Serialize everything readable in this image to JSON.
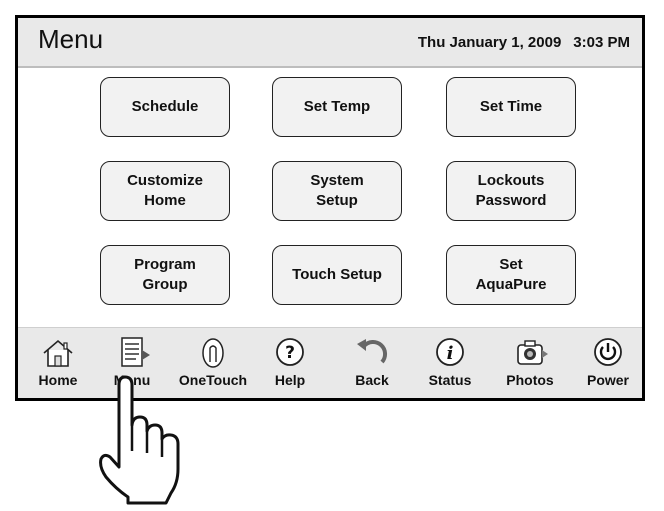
{
  "header": {
    "title": "Menu",
    "date": "Thu January 1, 2009",
    "time": "3:03 PM"
  },
  "menu_buttons": [
    {
      "label": "Schedule"
    },
    {
      "label": "Set Temp"
    },
    {
      "label": "Set Time"
    },
    {
      "label": "Customize\nHome"
    },
    {
      "label": "System\nSetup"
    },
    {
      "label": "Lockouts\nPassword"
    },
    {
      "label": "Program\nGroup"
    },
    {
      "label": "Touch Setup"
    },
    {
      "label": "Set\nAquaPure"
    }
  ],
  "nav_bar": [
    {
      "label": "Home",
      "icon": "house-icon"
    },
    {
      "label": "Menu",
      "icon": "menu-page-icon"
    },
    {
      "label": "OneTouch",
      "icon": "finger-touch-icon"
    },
    {
      "label": "Help",
      "icon": "question-icon"
    },
    {
      "label": "Back",
      "icon": "back-arrow-icon"
    },
    {
      "label": "Status",
      "icon": "info-icon"
    },
    {
      "label": "Photos",
      "icon": "camera-icon"
    },
    {
      "label": "Power",
      "icon": "power-icon"
    }
  ],
  "colors": {
    "header_bg": "#e9e9e9",
    "button_bg": "#f2f2f2",
    "border": "#000000"
  }
}
